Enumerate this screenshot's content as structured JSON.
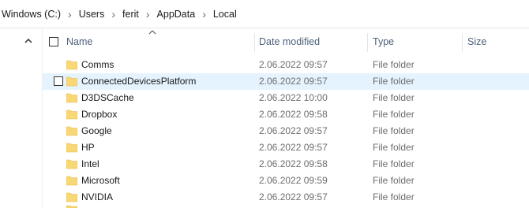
{
  "breadcrumb": [
    "Windows (C:)",
    "Users",
    "ferit",
    "AppData",
    "Local"
  ],
  "columns": {
    "name": "Name",
    "date_modified": "Date modified",
    "type": "Type",
    "size": "Size"
  },
  "sort": {
    "column": "Name",
    "direction": "ascending"
  },
  "rows": [
    {
      "name": "Comms",
      "date": "2.06.2022 09:57",
      "type": "File folder"
    },
    {
      "name": "ConnectedDevicesPlatform",
      "date": "2.06.2022 09:57",
      "type": "File folder",
      "hovered": true
    },
    {
      "name": "D3DSCache",
      "date": "2.06.2022 10:00",
      "type": "File folder"
    },
    {
      "name": "Dropbox",
      "date": "2.06.2022 09:58",
      "type": "File folder"
    },
    {
      "name": "Google",
      "date": "2.06.2022 09:57",
      "type": "File folder"
    },
    {
      "name": "HP",
      "date": "2.06.2022 09:57",
      "type": "File folder"
    },
    {
      "name": "Intel",
      "date": "2.06.2022 09:58",
      "type": "File folder"
    },
    {
      "name": "Microsoft",
      "date": "2.06.2022 09:59",
      "type": "File folder"
    },
    {
      "name": "NVIDIA",
      "date": "2.06.2022 09:57",
      "type": "File folder"
    }
  ],
  "colors": {
    "folder": "#f8d775",
    "folder_dark": "#e7b949",
    "hover": "#e5f3ff",
    "header_text": "#4c607a"
  },
  "icons": {
    "folder": "folder-icon",
    "separator": "chevron-right-icon",
    "scroll": "chevron-up-icon",
    "sort": "sort-ascending-icon"
  }
}
